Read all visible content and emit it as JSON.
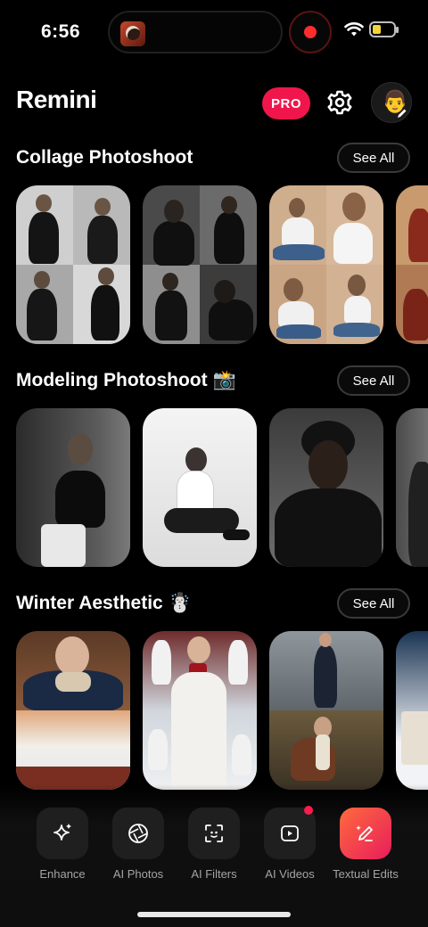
{
  "status": {
    "time": "6:56"
  },
  "header": {
    "title": "Remini",
    "pro_label": "PRO"
  },
  "sections": [
    {
      "title": "Collage Photoshoot",
      "emoji": "",
      "see_all": "See All"
    },
    {
      "title": "Modeling Photoshoot",
      "emoji": "📸",
      "see_all": "See All"
    },
    {
      "title": "Winter Aesthetic",
      "emoji": "☃️",
      "see_all": "See All"
    }
  ],
  "tabs": [
    {
      "label": "Enhance",
      "icon": "sparkle-icon"
    },
    {
      "label": "AI Photos",
      "icon": "aperture-icon"
    },
    {
      "label": "AI Filters",
      "icon": "face-scan-icon"
    },
    {
      "label": "AI Videos",
      "icon": "video-play-icon"
    },
    {
      "label": "Textual Edits",
      "icon": "pencil-sparkle-icon"
    }
  ],
  "colors": {
    "accent": "#f0164b",
    "active_tab_start": "#ff6a3d",
    "active_tab_end": "#e81d5c",
    "badge_dot": "#ff1a4d"
  }
}
